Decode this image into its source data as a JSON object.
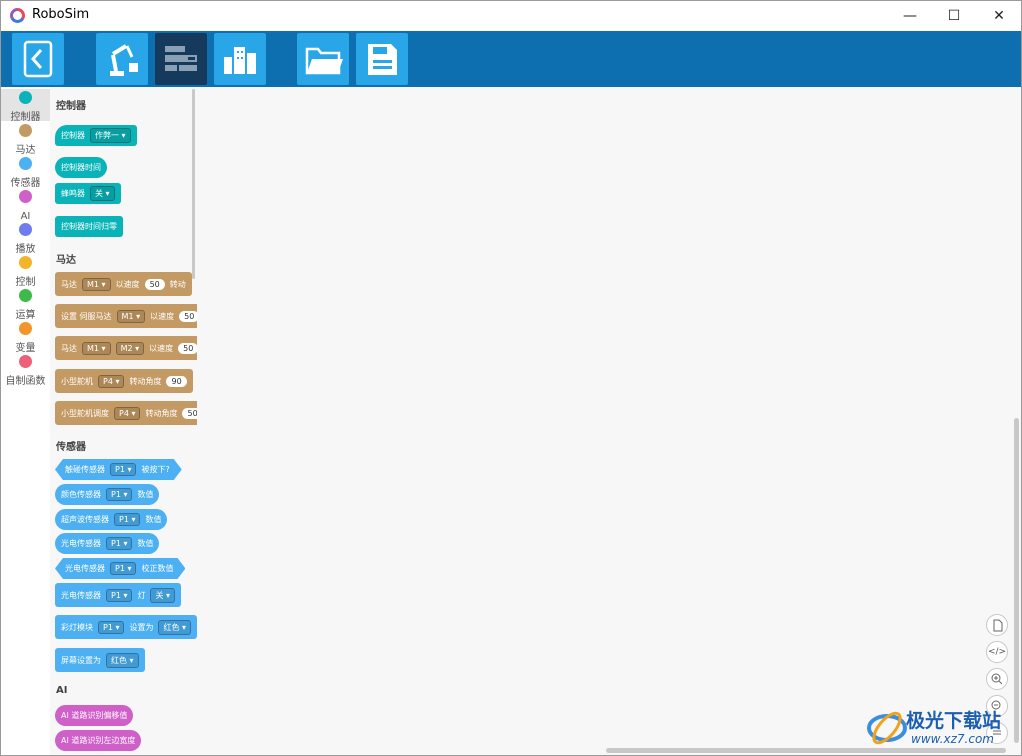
{
  "window": {
    "title": "RoboSim",
    "minimize_glyph": "—",
    "maximize_glyph": "☐",
    "close_glyph": "✕"
  },
  "toolbar": {
    "buttons": [
      {
        "name": "back",
        "icon": "back-arrow-icon"
      },
      {
        "name": "robot-arm",
        "icon": "robot-arm-icon"
      },
      {
        "name": "block-code",
        "icon": "block-code-icon",
        "active": true
      },
      {
        "name": "scene",
        "icon": "buildings-icon"
      },
      {
        "name": "open",
        "icon": "folder-icon"
      },
      {
        "name": "save",
        "icon": "save-disk-icon"
      }
    ]
  },
  "categories": [
    {
      "label": "控制器",
      "color": "#09b3b8"
    },
    {
      "label": "马达",
      "color": "#c49a64"
    },
    {
      "label": "传感器",
      "color": "#4cb0f2"
    },
    {
      "label": "AI",
      "color": "#cf60c7"
    },
    {
      "label": "播放",
      "color": "#6f7cf0"
    },
    {
      "label": "控制",
      "color": "#f2b52a"
    },
    {
      "label": "运算",
      "color": "#3dbb4a"
    },
    {
      "label": "变量",
      "color": "#f2952a"
    },
    {
      "label": "自制函数",
      "color": "#ee5f7a"
    }
  ],
  "flyout": {
    "sec_controller": "控制器",
    "b1": {
      "a": "控制器",
      "dd": "作弊一"
    },
    "b2": {
      "a": "控制器时间"
    },
    "b3": {
      "a": "蜂鸣器",
      "dd": "关"
    },
    "b4": {
      "a": "控制器时间归零"
    },
    "sec_motor": "马达",
    "m1": {
      "a": "马达",
      "dd": "M1",
      "b": "以速度",
      "n": "50",
      "c": "转动"
    },
    "m2": {
      "a": "设置 伺服马达",
      "dd": "M1",
      "b": "以速度",
      "n": "50"
    },
    "m3": {
      "a": "马达",
      "dd": "M1",
      "dd2": "M2",
      "b": "以速度",
      "n": "50"
    },
    "m4": {
      "a": "小型舵机",
      "dd": "P4",
      "b": "转动角度",
      "n": "90"
    },
    "m5": {
      "a": "小型舵机调度",
      "dd": "P4",
      "b": "转动角度",
      "n": "50"
    },
    "sec_sensor": "传感器",
    "s1": {
      "a": "触碰传感器",
      "dd": "P1",
      "b": "被按下?"
    },
    "s2": {
      "a": "颜色传感器",
      "dd": "P1",
      "b": "数值"
    },
    "s3": {
      "a": "超声波传感器",
      "dd": "P1",
      "b": "数值"
    },
    "s4": {
      "a": "光电传感器",
      "dd": "P1",
      "b": "数值"
    },
    "s5": {
      "a": "光电传感器",
      "dd": "P1",
      "b": "校正数值"
    },
    "s6": {
      "a": "光电传感器",
      "dd": "P1",
      "b": "灯",
      "dd2": "关"
    },
    "s7": {
      "a": "彩灯模块",
      "dd": "P1",
      "b": "设置为",
      "dd2": "红色"
    },
    "s8": {
      "a": "屏幕设置为",
      "dd": "红色"
    },
    "sec_ai": "AI",
    "a1": {
      "a": "AI 道路识别偏移值"
    },
    "a2": {
      "a": "AI 道路识别左边宽度"
    }
  },
  "zoom_controls": [
    {
      "name": "page",
      "icon": "page-icon"
    },
    {
      "name": "code",
      "icon": "code-icon",
      "glyph": "</>"
    },
    {
      "name": "zoom-in",
      "icon": "zoom-in-icon"
    },
    {
      "name": "zoom-reset",
      "icon": "zoom-reset-icon"
    },
    {
      "name": "zoom-out",
      "icon": "zoom-out-icon"
    }
  ],
  "watermark": {
    "text": "极光下载站",
    "url": "www.xz7.com"
  }
}
